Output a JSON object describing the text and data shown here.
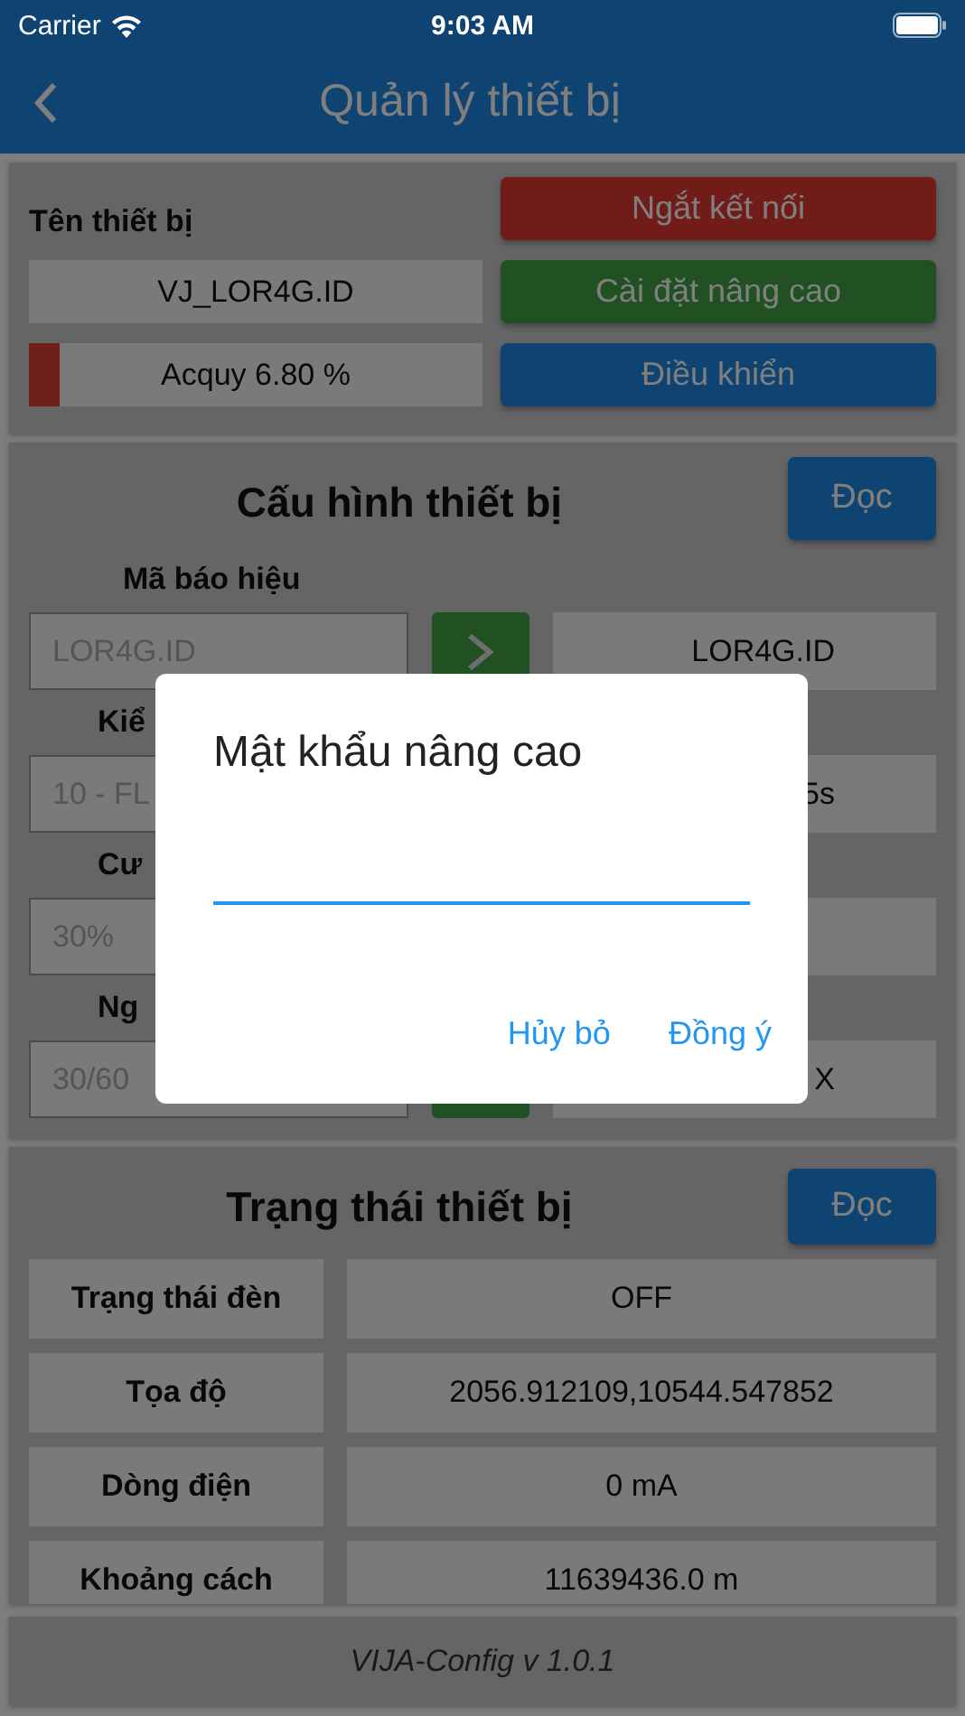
{
  "status_bar": {
    "carrier": "Carrier",
    "time": "9:03 AM"
  },
  "nav": {
    "title": "Quản lý thiết bị"
  },
  "device": {
    "name_label": "Tên thiết bị",
    "name": "VJ_LOR4G.ID",
    "battery": {
      "text": "Acquy 6.80 %",
      "level": 0.068
    },
    "buttons": [
      {
        "label": "Ngắt kết nối",
        "kind": "danger"
      },
      {
        "label": "Cài đặt nâng cao",
        "kind": "success"
      },
      {
        "label": "Điều khiển",
        "kind": "primary"
      }
    ]
  },
  "config": {
    "title": "Cấu hình thiết bị",
    "read_button": "Đọc",
    "rows": [
      {
        "label": "Mã báo hiệu",
        "placeholder": "LOR4G.ID",
        "value": "LOR4G.ID",
        "send_button": true
      },
      {
        "label": "Kiể",
        "placeholder": "10 - FL",
        "value": "5s"
      },
      {
        "label": "Cư",
        "placeholder": "30%"
      },
      {
        "label": "Ng",
        "placeholder": "30/60",
        "value": "X",
        "send_button": true
      }
    ]
  },
  "status": {
    "title": "Trạng thái thiết bị",
    "read_button": "Đọc",
    "rows": [
      {
        "label": "Trạng thái đèn",
        "value": "OFF"
      },
      {
        "label": "Tọa độ",
        "value": "2056.912109,10544.547852"
      },
      {
        "label": "Dòng điện",
        "value": "0 mA"
      },
      {
        "label": "Khoảng cách",
        "value": "11639436.0 m"
      }
    ]
  },
  "footer": {
    "text": "VIJA-Config v 1.0.1"
  },
  "dialog": {
    "title": "Mật khẩu nâng cao",
    "buttons": [
      "Hủy bỏ",
      "Đồng ý"
    ]
  }
}
